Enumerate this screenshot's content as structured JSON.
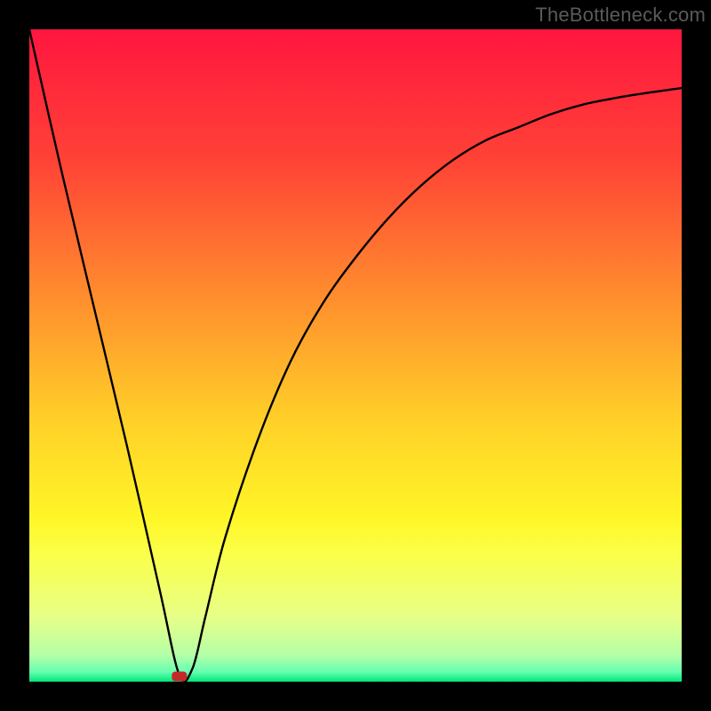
{
  "attribution": "TheBottleneck.com",
  "chart_data": {
    "type": "line",
    "title": "",
    "xlabel": "",
    "ylabel": "",
    "xlim": [
      0,
      100
    ],
    "ylim": [
      0,
      100
    ],
    "x": [
      0,
      5,
      10,
      15,
      20,
      23,
      25,
      27,
      30,
      35,
      40,
      45,
      50,
      55,
      60,
      65,
      70,
      75,
      80,
      85,
      90,
      95,
      100
    ],
    "values": [
      100,
      78,
      57,
      36,
      14,
      1,
      2,
      10,
      22,
      37,
      49,
      58,
      65,
      71,
      76,
      80,
      83,
      85,
      87,
      88.5,
      89.5,
      90.3,
      91
    ],
    "annotations": [
      {
        "type": "marker",
        "shape": "rounded-rect",
        "x": 23,
        "y": 0.8,
        "color": "#c22a2a"
      }
    ],
    "background": {
      "type": "vertical-gradient",
      "stops": [
        {
          "pos": 0.0,
          "color": "#ff163f"
        },
        {
          "pos": 0.2,
          "color": "#ff4236"
        },
        {
          "pos": 0.4,
          "color": "#ff8a2e"
        },
        {
          "pos": 0.6,
          "color": "#ffd028"
        },
        {
          "pos": 0.75,
          "color": "#fff627"
        },
        {
          "pos": 0.8,
          "color": "#fbff46"
        },
        {
          "pos": 0.9,
          "color": "#e8ff87"
        },
        {
          "pos": 0.96,
          "color": "#b3ffa8"
        },
        {
          "pos": 0.985,
          "color": "#66ffb0"
        },
        {
          "pos": 1.0,
          "color": "#00e47a"
        }
      ]
    }
  }
}
